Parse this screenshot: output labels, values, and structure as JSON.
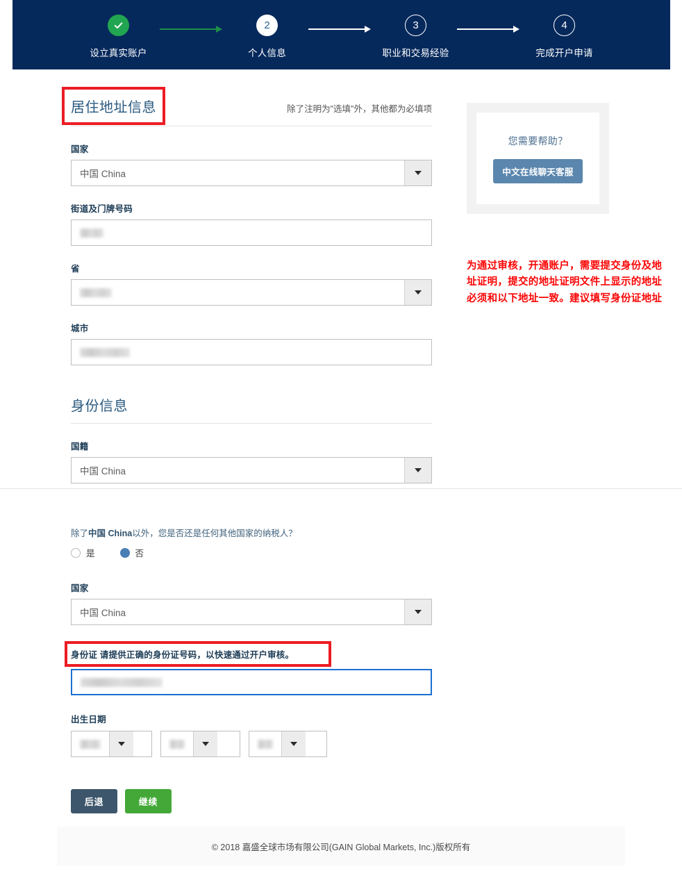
{
  "stepper": {
    "steps": [
      {
        "id": "step-1",
        "marker": "✓",
        "label": "设立真实账户",
        "state": "done"
      },
      {
        "id": "step-2",
        "marker": "2",
        "label": "个人信息",
        "state": "current"
      },
      {
        "id": "step-3",
        "marker": "3",
        "label": "职业和交易经验",
        "state": "upcoming"
      },
      {
        "id": "step-4",
        "marker": "4",
        "label": "完成开户申请",
        "state": "upcoming"
      }
    ],
    "colors": {
      "bar_background": "#06295c",
      "done": "#22a550",
      "connector_done": "#1e8f47",
      "connector_pending": "#ffffff"
    }
  },
  "address_section": {
    "title": "居住地址信息",
    "note": "除了注明为\"选填\"外，其他都为必填项",
    "highlight_color": "#ec1c24",
    "fields": {
      "country": {
        "label": "国家",
        "value": "中国 China",
        "type": "select"
      },
      "street": {
        "label": "街道及门牌号码",
        "value": "",
        "type": "text",
        "redacted": true
      },
      "province": {
        "label": "省",
        "value": "",
        "type": "select",
        "redacted": true
      },
      "city": {
        "label": "城市",
        "value": "",
        "type": "text",
        "redacted": true
      }
    }
  },
  "identity_section": {
    "title": "身份信息",
    "fields": {
      "nationality": {
        "label": "国籍",
        "value": "中国 China",
        "type": "select"
      }
    }
  },
  "tax_section": {
    "question_prefix": "除了",
    "question_country": "中国 China",
    "question_suffix": "以外，您是否还是任何其他国家的纳税人？",
    "options": [
      {
        "label": "是",
        "selected": false
      },
      {
        "label": "否",
        "selected": true
      }
    ],
    "country": {
      "label": "国家",
      "value": "中国 China",
      "type": "select"
    },
    "id_number": {
      "label": "身份证 请提供正确的身份证号码，以快速通过开户审核。",
      "value": "",
      "redacted": true,
      "focused": true,
      "focus_color": "#1a6fd0",
      "highlight_color": "#ec1c24"
    },
    "birthdate": {
      "label": "出生日期",
      "year": "",
      "month": "",
      "day": ""
    }
  },
  "actions": {
    "back": {
      "label": "后退",
      "color": "#3d566b"
    },
    "continue": {
      "label": "继续",
      "color": "#43a838"
    }
  },
  "aside": {
    "help_title": "您需要帮助？",
    "help_button": "中文在线聊天客服",
    "note": "为通过审核，开通账户，需要提交身份及地址证明，提交的地址证明文件上显示的地址必须和以下地址一致。建议填写身份证地址",
    "note_color": "#fa0505"
  },
  "footer": {
    "copyright": "© 2018 嘉盛全球市场有限公司(GAIN Global Markets, Inc.)版权所有"
  }
}
